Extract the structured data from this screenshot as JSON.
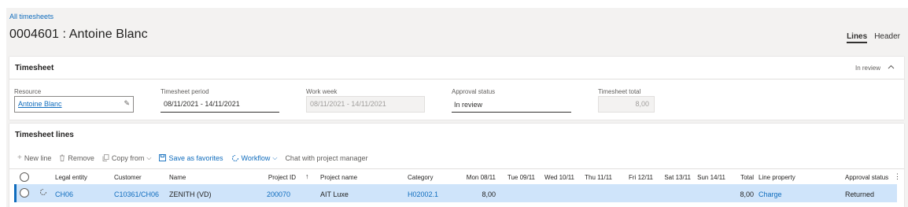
{
  "breadcrumb": "All timesheets",
  "title": "0004601 : Antoine Blanc",
  "view_tabs": {
    "lines": "Lines",
    "header": "Header"
  },
  "timesheet_section": {
    "title": "Timesheet",
    "status_summary": "In review",
    "fields": {
      "resource": {
        "label": "Resource",
        "value": "Antoine Blanc"
      },
      "period": {
        "label": "Timesheet period",
        "value": "08/11/2021 - 14/11/2021"
      },
      "work_week": {
        "label": "Work week",
        "value": "08/11/2021 - 14/11/2021"
      },
      "approval": {
        "label": "Approval status",
        "value": "In review"
      },
      "total": {
        "label": "Timesheet total",
        "value": "8,00"
      }
    }
  },
  "lines_section": {
    "title": "Timesheet lines",
    "toolbar": {
      "new_line": "New line",
      "remove": "Remove",
      "copy_from": "Copy from",
      "save_favorites": "Save as favorites",
      "workflow": "Workflow",
      "chat": "Chat with project manager"
    },
    "columns": {
      "legal_entity": "Legal entity",
      "customer": "Customer",
      "name": "Name",
      "project_id": "Project ID",
      "project_name": "Project name",
      "category": "Category",
      "mon": "Mon 08/11",
      "tue": "Tue 09/11",
      "wed": "Wed 10/11",
      "thu": "Thu 11/11",
      "fri": "Fri 12/11",
      "sat": "Sat 13/11",
      "sun": "Sun 14/11",
      "total": "Total",
      "line_property": "Line property",
      "approval_status": "Approval status"
    },
    "rows": [
      {
        "legal_entity": "CH06",
        "customer": "C10361/CH06",
        "name": "ZENITH (VD)",
        "project_id": "200070",
        "project_name": "AIT Luxe",
        "category": "H02002.1",
        "mon": "8,00",
        "total": "8,00",
        "line_property": "Charge",
        "approval_status": "Returned"
      }
    ]
  },
  "colors": {
    "accent": "#0f6cbd",
    "selected_row": "#cfe4fa",
    "page_bg": "#f3f2f1"
  }
}
